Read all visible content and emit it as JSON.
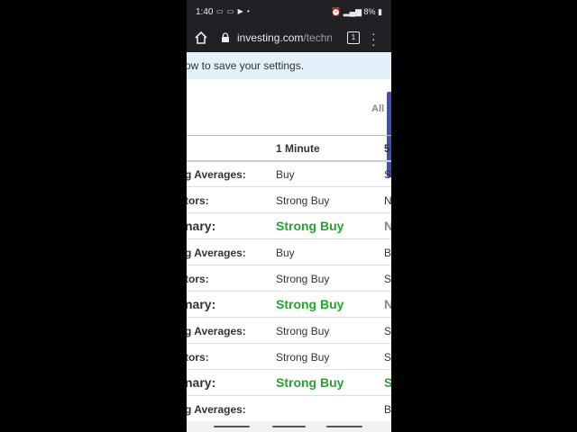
{
  "status_bar": {
    "time": "1:40",
    "left_icons": "▭ ▭ ▶ •",
    "battery": "8%"
  },
  "browser": {
    "url_host": "investing.com",
    "url_path": "/techni",
    "tab_count": "1"
  },
  "banner": {
    "text": "ow to save your settings."
  },
  "all_link": "All",
  "table": {
    "columns": [
      "1 Minute",
      "5"
    ],
    "rows": [
      {
        "label": "g Averages:",
        "v1": "Buy",
        "v2": "S",
        "summary": false
      },
      {
        "label": "tors:",
        "v1": "Strong Buy",
        "v2": "N",
        "summary": false
      },
      {
        "label": "nary:",
        "v1": "Strong Buy",
        "v2": "N",
        "summary": true,
        "v2_color": "gray"
      },
      {
        "label": "g Averages:",
        "v1": "Buy",
        "v2": "B",
        "summary": false
      },
      {
        "label": "tors:",
        "v1": "Strong Buy",
        "v2": "S",
        "summary": false
      },
      {
        "label": "nary:",
        "v1": "Strong Buy",
        "v2": "N",
        "summary": true,
        "v2_color": "gray"
      },
      {
        "label": "g Averages:",
        "v1": "Strong Buy",
        "v2": "S",
        "summary": false
      },
      {
        "label": "tors:",
        "v1": "Strong Buy",
        "v2": "S",
        "summary": false
      },
      {
        "label": "nary:",
        "v1": "Strong Buy",
        "v2": "S",
        "summary": true,
        "v2_color": "green"
      },
      {
        "label": "g Averages:",
        "v1": "",
        "v2": "B",
        "summary": false
      }
    ]
  },
  "colors": {
    "accent_green": "#23a62d",
    "banner_bg": "#e3f1fb",
    "browser_bar": "#202124",
    "scroll_handle": "#3f51b5"
  }
}
